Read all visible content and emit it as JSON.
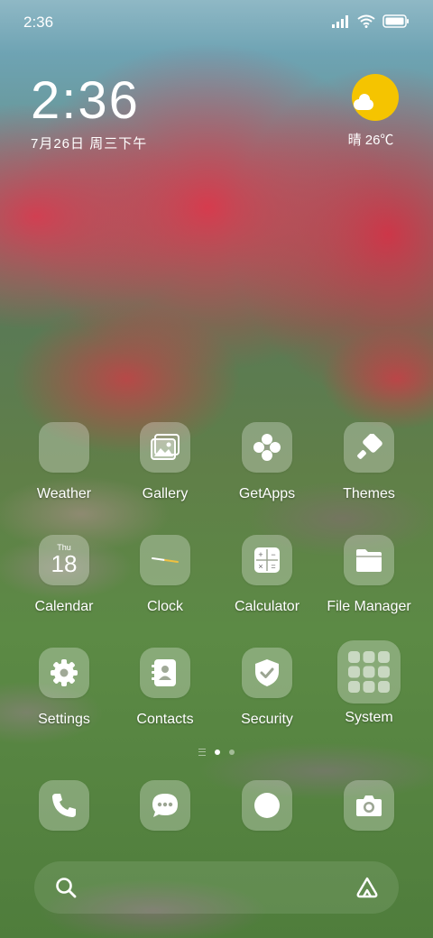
{
  "status_bar": {
    "time": "2:36"
  },
  "clock_widget": {
    "time": "2:36",
    "date": "7月26日 周三下午"
  },
  "weather_widget": {
    "text": "晴 26℃"
  },
  "apps": {
    "row1": [
      "Weather",
      "Gallery",
      "GetApps",
      "Themes"
    ],
    "row2": [
      "Calendar",
      "Clock",
      "Calculator",
      "File Manager"
    ],
    "row3": [
      "Settings",
      "Contacts",
      "Security",
      "System"
    ]
  },
  "calendar_icon": {
    "weekday": "Thu",
    "day": "18"
  },
  "colors": {
    "sun": "#f5c400",
    "icon_bg": "rgba(255,255,255,0.28)"
  },
  "dock": [
    "phone-icon",
    "messages-icon",
    "browser-icon",
    "camera-icon"
  ]
}
